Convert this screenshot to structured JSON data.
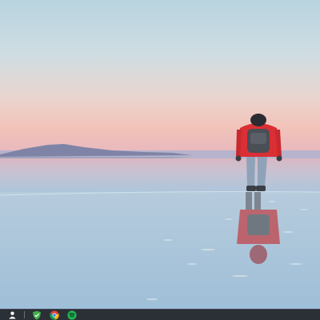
{
  "desktop": {
    "wallpaper": {
      "scene": "salt-flat-reflection-hiker",
      "sky_top": "#b8d4e0",
      "sky_horizon": "#f2c3b9",
      "water_color": "#a9c6dc",
      "jacket_color": "#d92f35"
    }
  },
  "taskbar": {
    "background": "#2b2f36",
    "icons": [
      {
        "name": "user-icon",
        "color": "#ffffff"
      },
      {
        "name": "shield-icon",
        "color": "#3fae49"
      },
      {
        "name": "chrome-icon",
        "color": "#db4437"
      },
      {
        "name": "spotify-icon",
        "color": "#1db954"
      }
    ]
  }
}
